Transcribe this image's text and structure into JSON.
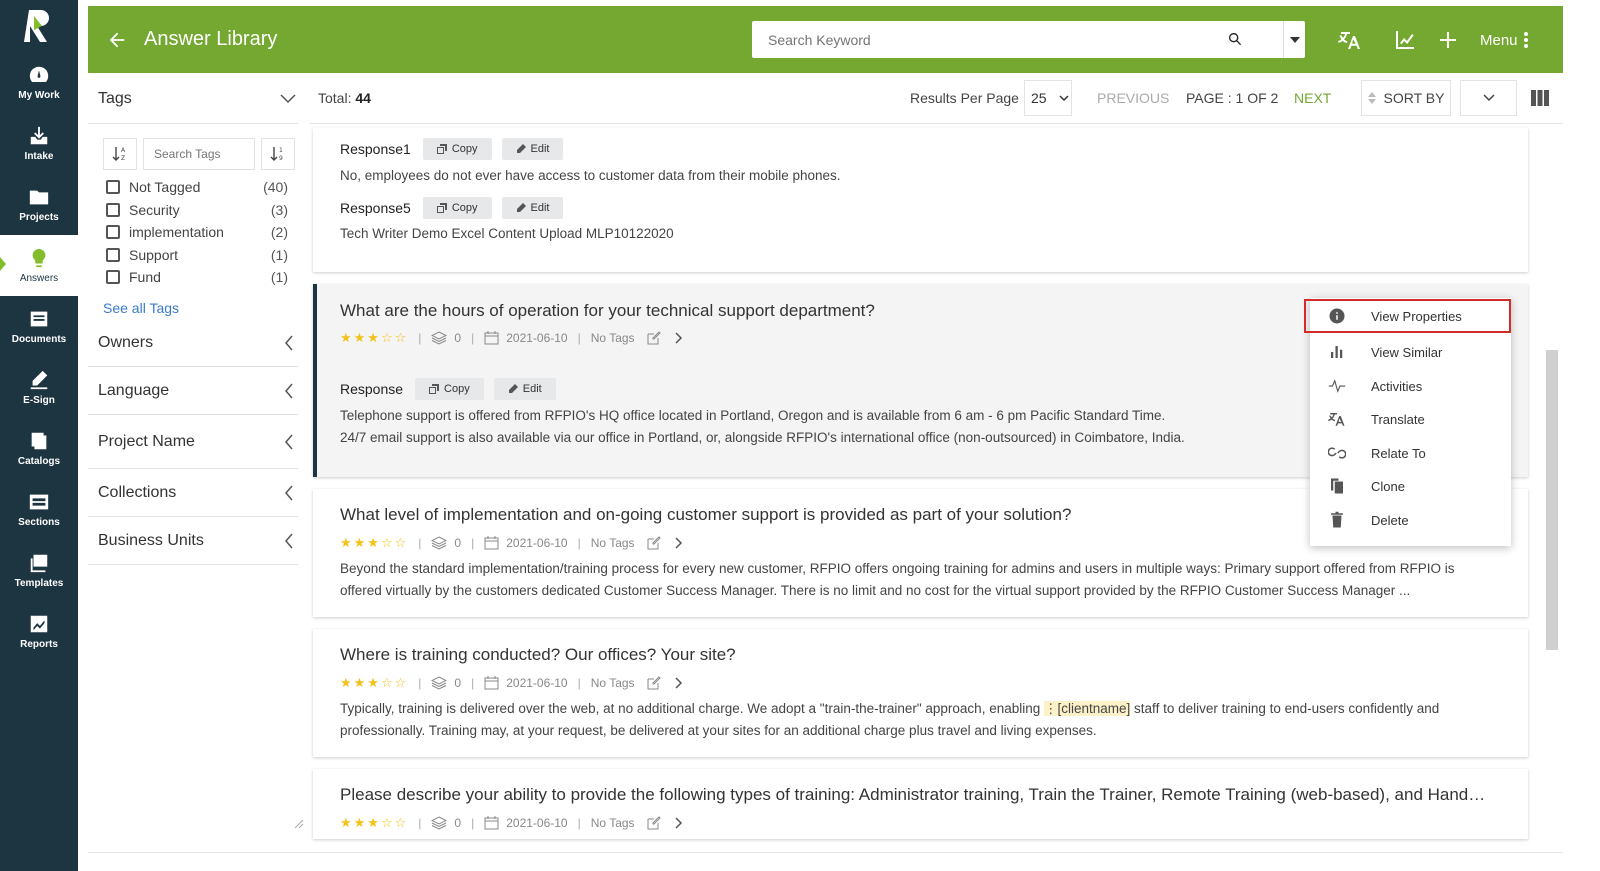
{
  "nav": {
    "items": [
      {
        "label": "My Work",
        "icon": "dashboard-icon"
      },
      {
        "label": "Intake",
        "icon": "intake-icon"
      },
      {
        "label": "Projects",
        "icon": "folder-icon"
      },
      {
        "label": "Answers",
        "icon": "lightbulb-icon",
        "active": true
      },
      {
        "label": "Documents",
        "icon": "documents-icon"
      },
      {
        "label": "E-Sign",
        "icon": "esign-icon"
      },
      {
        "label": "Catalogs",
        "icon": "catalog-icon"
      },
      {
        "label": "Sections",
        "icon": "sections-icon"
      },
      {
        "label": "Templates",
        "icon": "templates-icon"
      },
      {
        "label": "Reports",
        "icon": "reports-icon"
      }
    ]
  },
  "header": {
    "title": "Answer Library",
    "search_placeholder": "Search Keyword",
    "menu_label": "Menu"
  },
  "toolbar": {
    "total_label": "Total:",
    "total_value": "44",
    "rpp_label": "Results Per Page",
    "rpp_value": "25",
    "previous": "PREVIOUS",
    "page_info": "PAGE : 1 OF 2",
    "next": "NEXT",
    "sort_by": "SORT BY"
  },
  "filters": {
    "tags_title": "Tags",
    "search_tags_placeholder": "Search Tags",
    "tags": [
      {
        "label": "Not Tagged",
        "count": "(40)"
      },
      {
        "label": "Security",
        "count": "(3)"
      },
      {
        "label": "implementation",
        "count": "(2)"
      },
      {
        "label": "Support",
        "count": "(1)"
      },
      {
        "label": "Fund",
        "count": "(1)"
      }
    ],
    "see_all": "See all Tags",
    "sections": [
      "Owners",
      "Language",
      "Project Name",
      "Collections",
      "Business Units"
    ]
  },
  "results": {
    "copy_label": "Copy",
    "edit_label": "Edit",
    "top_card": {
      "r1_label": "Response1",
      "r1_text": "No, employees do not ever have access to customer data from their mobile phones.",
      "r5_label": "Response5",
      "r5_text": "Tech Writer Demo Excel Content Upload MLP10122020"
    },
    "items": [
      {
        "question": "What are the hours of operation for your technical support department?",
        "count": "0",
        "date": "2021-06-10",
        "tags": "No Tags",
        "response_label": "Response",
        "answer_line1": "Telephone support is offered from RFPIO's HQ office located in Portland, Oregon and is available from 6 am - 6 pm Pacific Standard Time.",
        "answer_line2": "24/7 email support is also available via our office in Portland, or, alongside RFPIO's international office (non-outsourced) in Coimbatore, India."
      },
      {
        "question": "What level of implementation and on-going customer support is provided as part of your solution?",
        "count": "0",
        "date": "2021-06-10",
        "tags": "No Tags",
        "answer": "Beyond the standard implementation/training process for every new customer, RFPIO offers ongoing training for admins and users in multiple ways: Primary support offered from RFPIO is offered virtually by the customers dedicated Customer Success Manager. There is no limit and no cost for the virtual support provided by the RFPIO Customer Success Manager ..."
      },
      {
        "question": "Where is training conducted? Our offices? Your site?",
        "count": "0",
        "date": "2021-06-10",
        "tags": "No Tags",
        "answer_pre": "Typically, training is delivered over the web, at no additional charge. We adopt a \"train-the-trainer\" approach, enabling ",
        "answer_var": "[clientname]",
        "answer_post": " staff to deliver training to end-users confidently and professionally. Training may, at your request, be delivered at your sites for an additional charge plus travel and living expenses."
      },
      {
        "question": "Please describe your ability to provide the following types of training: Administrator training, Train the Trainer, Remote Training (web-based), and Hand…",
        "count": "0",
        "date": "2021-06-10",
        "tags": "No Tags"
      }
    ]
  },
  "context_menu": {
    "items": [
      {
        "label": "View Properties",
        "icon": "info-icon"
      },
      {
        "label": "View Similar",
        "icon": "bar-chart-icon"
      },
      {
        "label": "Activities",
        "icon": "activity-icon"
      },
      {
        "label": "Translate",
        "icon": "translate-icon"
      },
      {
        "label": "Relate To",
        "icon": "link-icon"
      },
      {
        "label": "Clone",
        "icon": "clone-icon"
      },
      {
        "label": "Delete",
        "icon": "trash-icon"
      }
    ]
  },
  "colors": {
    "brand_green": "#74a830",
    "nav_bg": "#1d3441",
    "star": "#f3c118",
    "link": "#3a7bc8",
    "highlight_border": "#d32a2a"
  }
}
